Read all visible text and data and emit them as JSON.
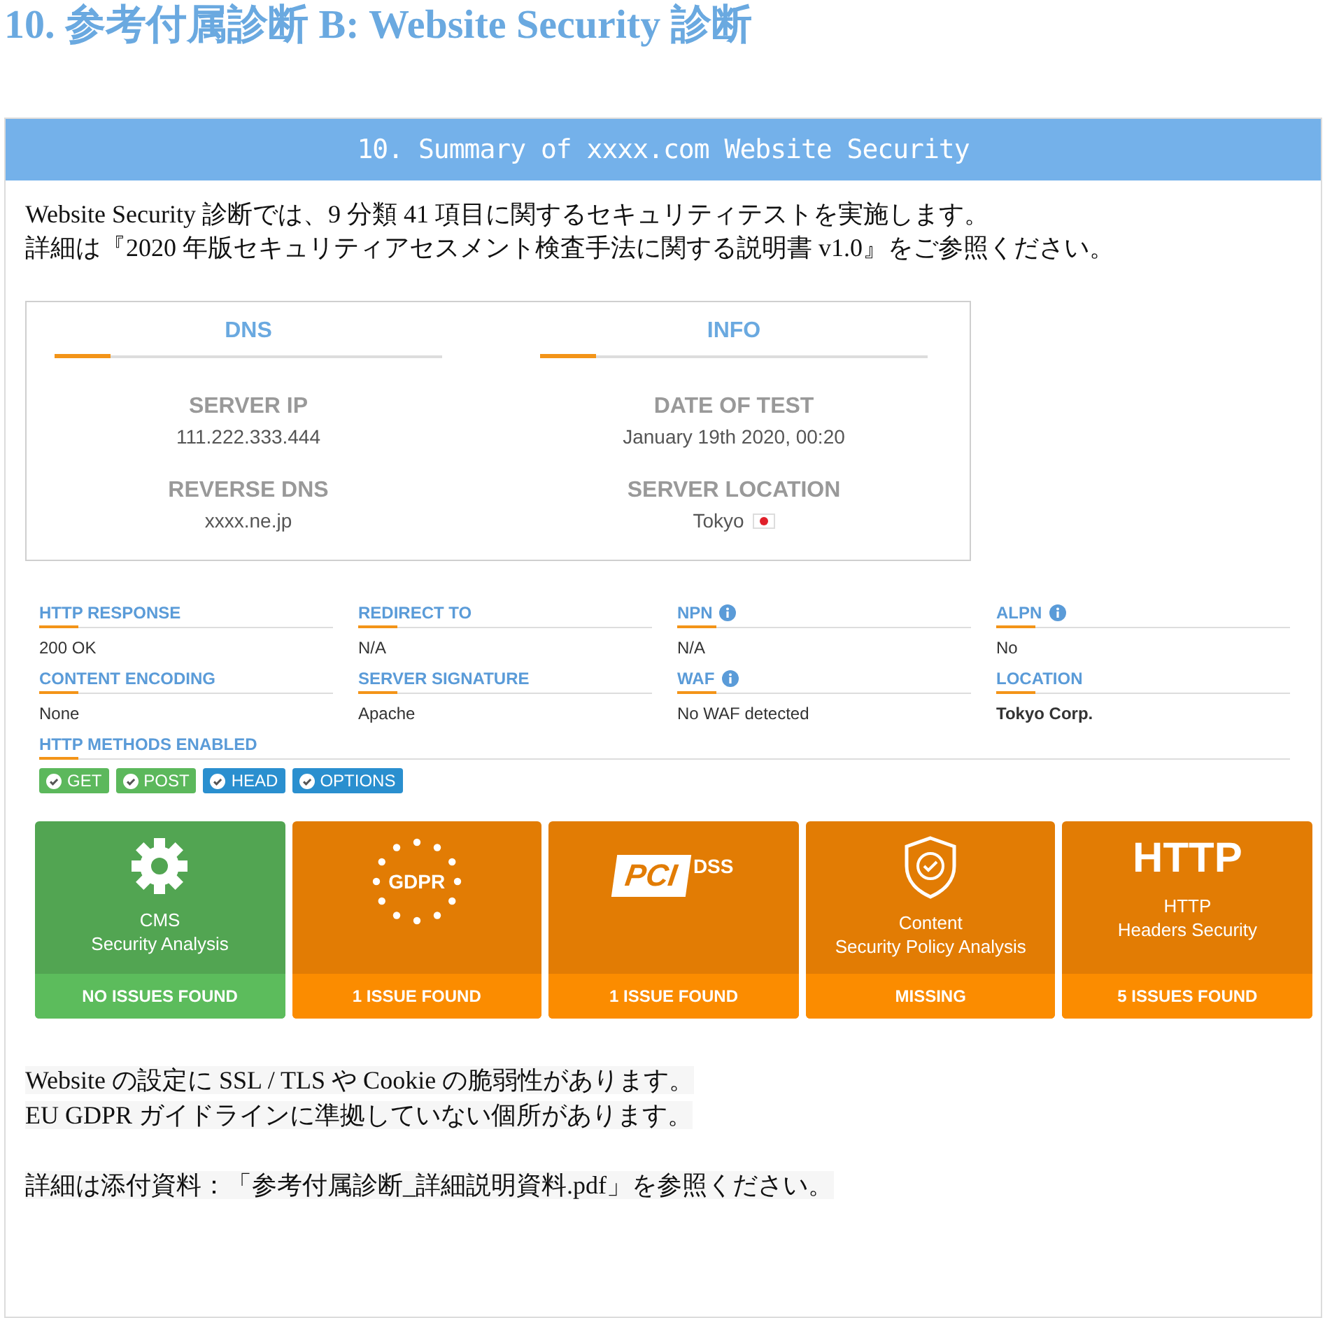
{
  "title": "10. 参考付属診断 B: Website Security 診断",
  "panel": {
    "header": "10. Summary of xxxx.com Website Security",
    "intro": [
      "Website Security 診断では、9 分類 41 項目に関するセキュリティテストを実施します。",
      "詳細は『2020 年版セキュリティアセスメント検査手法に関する説明書 v1.0』をご参照ください。"
    ],
    "summary_sections": [
      {
        "heading": "DNS",
        "fields": [
          {
            "label": "SERVER IP",
            "value": "111.222.333.444"
          },
          {
            "label": "REVERSE DNS",
            "value": "xxxx.ne.jp"
          }
        ]
      },
      {
        "heading": "INFO",
        "fields": [
          {
            "label": "DATE OF TEST",
            "value": "January 19th 2020, 00:20"
          },
          {
            "label": "SERVER LOCATION",
            "value": "Tokyo",
            "flag": true
          }
        ]
      }
    ],
    "details": [
      {
        "label": "HTTP RESPONSE",
        "value": "200 OK",
        "info": false,
        "bold": false
      },
      {
        "label": "REDIRECT TO",
        "value": "N/A",
        "info": false,
        "bold": false
      },
      {
        "label": "NPN",
        "value": "N/A",
        "info": true,
        "bold": false
      },
      {
        "label": "ALPN",
        "value": "No",
        "info": true,
        "bold": false
      },
      {
        "label": "CONTENT ENCODING",
        "value": "None",
        "info": false,
        "bold": false
      },
      {
        "label": "SERVER SIGNATURE",
        "value": "Apache",
        "info": false,
        "bold": false
      },
      {
        "label": "WAF",
        "value": "No WAF detected",
        "info": true,
        "bold": false
      },
      {
        "label": "LOCATION",
        "value": "Tokyo Corp.",
        "info": false,
        "bold": true
      }
    ],
    "methods": {
      "label": "HTTP METHODS ENABLED",
      "items": [
        {
          "name": "GET",
          "color": "#5cb85c"
        },
        {
          "name": "POST",
          "color": "#5cb85c"
        },
        {
          "name": "HEAD",
          "color": "#2a8fcf"
        },
        {
          "name": "OPTIONS",
          "color": "#2a8fcf"
        }
      ]
    },
    "checks": [
      {
        "kind": "gear",
        "title": [
          "CMS",
          "Security Analysis"
        ],
        "status": "NO ISSUES FOUND",
        "ok": true
      },
      {
        "kind": "gdpr",
        "logo": "GDPR",
        "status": "1 ISSUE FOUND",
        "ok": false
      },
      {
        "kind": "pci",
        "logo": "PCI",
        "logo_suffix": "DSS",
        "status": "1 ISSUE FOUND",
        "ok": false
      },
      {
        "kind": "shield",
        "title": [
          "Content",
          "Security Policy Analysis"
        ],
        "status": "MISSING",
        "ok": false
      },
      {
        "kind": "http",
        "logo": "HTTP",
        "title": [
          "HTTP",
          "Headers Security"
        ],
        "status": "5 ISSUES FOUND",
        "ok": false
      }
    ],
    "findings": [
      "Website の設定に SSL / TLS や Cookie の脆弱性があります。",
      "EU GDPR ガイドラインに準拠していない個所があります。"
    ],
    "reference": "詳細は添付資料：「参考付属診断_詳細説明資料.pdf」を参照ください。"
  }
}
